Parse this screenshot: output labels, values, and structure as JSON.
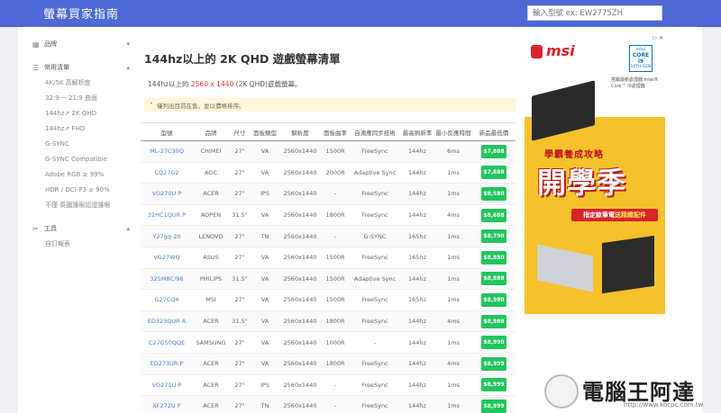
{
  "header": {
    "brand": "螢幕買家指南",
    "search_placeholder": "輸入型號 ex: EW2775ZH"
  },
  "sidebar": {
    "sections": [
      {
        "icon": "grid-icon",
        "label": "品牌",
        "chevron": "▾",
        "items": []
      },
      {
        "icon": "list-icon",
        "label": "常用清單",
        "chevron": "▴",
        "items": [
          "4K/5K 高解析度",
          "32:9 ~ 21:9 曲面",
          "144hz↗ 2K QHD",
          "144hz↗ FHD",
          "G-SYNC",
          "G-SYNC Compatible",
          "Adobe RGB ≥ 99%",
          "HDR / DCI-P3 ≥ 90%",
          "不僅 英國護眼認證護眼"
        ]
      },
      {
        "icon": "tools-icon",
        "label": "工具",
        "chevron": "▴",
        "items": [
          "自訂報表"
        ]
      }
    ]
  },
  "main": {
    "title": "144hz以上的 2K QHD 遊戲螢幕清單",
    "intro_prefix": "144hz以上的 ",
    "intro_highlight": "2560 x 1440",
    "intro_suffix": " (2K QHD)遊戲螢幕。",
    "note": "僅列出目前在售，並以價格排序。"
  },
  "table": {
    "headers": [
      "型號",
      "品牌",
      "尺寸",
      "面板類型",
      "解析度",
      "面板曲率",
      "自適應同步技術",
      "最高刷新率",
      "最小反應時間",
      "新品最低價"
    ],
    "rows": [
      [
        "ML-27C30Q",
        "CHIMEI",
        "27\"",
        "VA",
        "2560x1440",
        "1500R",
        "FreeSync",
        "144hz",
        "6ms",
        "$7,888"
      ],
      [
        "CQ27G2",
        "AOC",
        "27\"",
        "VA",
        "2560x1440",
        "2000R",
        "Adaptive Sync",
        "144hz",
        "1ms",
        "$7,888"
      ],
      [
        "VG270U P",
        "ACER",
        "27\"",
        "IPS",
        "2560x1440",
        "-",
        "FreeSync",
        "144hz",
        "1ms",
        "$8,580"
      ],
      [
        "32HC1QUR P",
        "AOPEN",
        "31.5\"",
        "VA",
        "2560x1440",
        "1800R",
        "FreeSync",
        "144hz",
        "4ms",
        "$8,688"
      ],
      [
        "Y27gq-20",
        "LENOVO",
        "27\"",
        "TN",
        "2560x1440",
        "-",
        "G-SYNC",
        "165hz",
        "1ms",
        "$8,790"
      ],
      [
        "VG27WQ",
        "ASUS",
        "27\"",
        "VA",
        "2560x1440",
        "1500R",
        "FreeSync",
        "165hz",
        "1ms",
        "$8,850"
      ],
      [
        "325M8C/96",
        "PHILIPS",
        "31.5\"",
        "VA",
        "2560x1440",
        "1500R",
        "Adaptive Sync",
        "144hz",
        "1ms",
        "$8,888"
      ],
      [
        "G27CQ4",
        "MSI",
        "27\"",
        "VA",
        "2560x1440",
        "1500R",
        "FreeSync",
        "165hz",
        "1ms",
        "$8,980"
      ],
      [
        "ED323QUR A",
        "ACER",
        "31.5\"",
        "VA",
        "2560x1440",
        "1800R",
        "FreeSync",
        "144hz",
        "4ms",
        "$8,988"
      ],
      [
        "C27G50QQE",
        "SAMSUNG",
        "27\"",
        "VA",
        "2560x1440",
        "1000R",
        "-",
        "144hz",
        "1ms",
        "$8,990"
      ],
      [
        "ED273UR P",
        "ACER",
        "27\"",
        "VA",
        "2560x1440",
        "1800R",
        "FreeSync",
        "144hz",
        "4ms",
        "$8,999"
      ],
      [
        "VG271U P",
        "ACER",
        "27\"",
        "IPS",
        "2560x1440",
        "-",
        "FreeSync",
        "144hz",
        "1ms",
        "$8,999"
      ],
      [
        "XF272U P",
        "ACER",
        "27\"",
        "TN",
        "2560x1440",
        "-",
        "FreeSync",
        "144hz",
        "1ms",
        "$8,999"
      ]
    ]
  },
  "ad": {
    "flag": "▷ ✕",
    "brand": "msi",
    "intel_line1": "intel",
    "intel_line2": "CORE i9",
    "intel_line3": "10TH GEN",
    "small_text": "搭載最新處理器 Intel® Core™ i9處理器",
    "subtitle": "學霸養成攻略",
    "headline": "開學季",
    "ribbon_prefix": "指定款筆電",
    "ribbon_highlight": "送精緻配件"
  },
  "watermark": {
    "text": "電腦王阿達",
    "url": "http://www.kocpc.com.tw"
  },
  "colors": {
    "topbar": "#4f68d6",
    "price_badge": "#22c55e",
    "link": "#4a7fd0",
    "highlight": "#d9372b"
  }
}
